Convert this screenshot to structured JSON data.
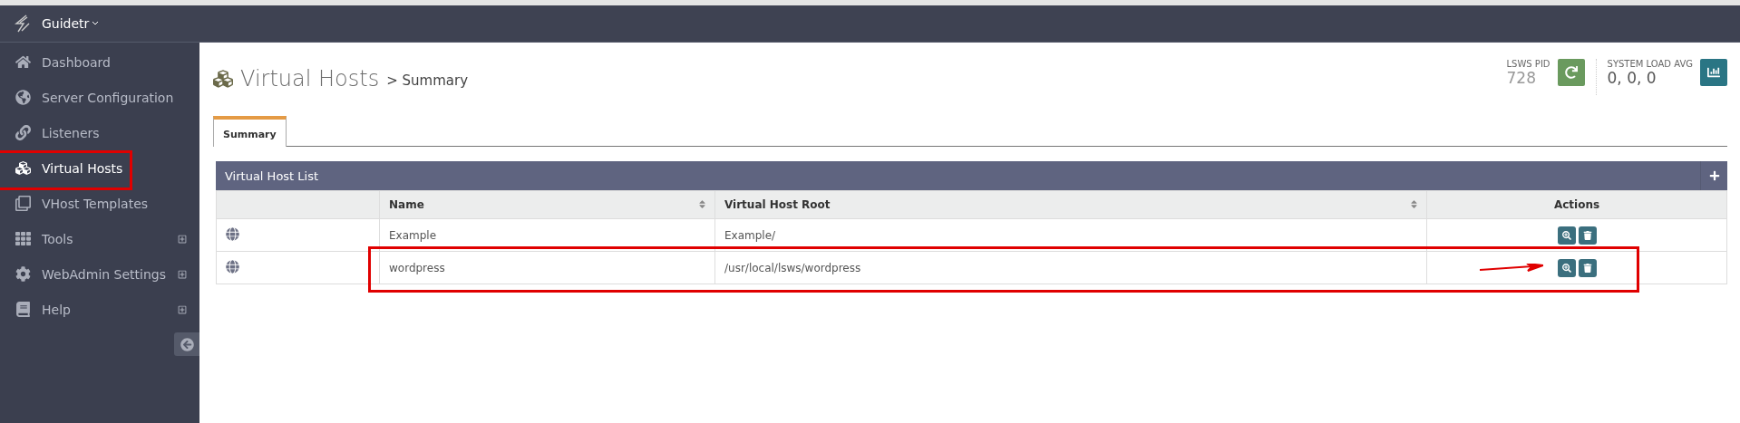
{
  "brand": {
    "name": "Guidetr"
  },
  "sidebar": {
    "items": [
      {
        "label": "Dashboard",
        "selected": false,
        "expandable": false,
        "highlighted": false
      },
      {
        "label": "Server Configuration",
        "selected": false,
        "expandable": false,
        "highlighted": false
      },
      {
        "label": "Listeners",
        "selected": false,
        "expandable": false,
        "highlighted": false
      },
      {
        "label": "Virtual Hosts",
        "selected": true,
        "expandable": false,
        "highlighted": true
      },
      {
        "label": "VHost Templates",
        "selected": false,
        "expandable": false,
        "highlighted": false
      },
      {
        "label": "Tools",
        "selected": false,
        "expandable": true,
        "highlighted": false
      },
      {
        "label": "WebAdmin Settings",
        "selected": false,
        "expandable": true,
        "highlighted": false
      },
      {
        "label": "Help",
        "selected": false,
        "expandable": true,
        "highlighted": false
      }
    ]
  },
  "page": {
    "title": "Virtual Hosts",
    "crumb": "> Summary"
  },
  "status": {
    "pid_label": "LSWS PID",
    "pid": "728",
    "load_label": "SYSTEM LOAD AVG",
    "load": "0, 0, 0"
  },
  "tabs": [
    {
      "label": "Summary",
      "selected": true
    }
  ],
  "panel": {
    "title": "Virtual Host List",
    "columns": [
      {
        "sortable": false
      },
      {
        "label": "Name",
        "sortable": true
      },
      {
        "label": "Virtual Host Root",
        "sortable": true
      },
      {
        "label": "Actions",
        "sortable": false
      }
    ],
    "rows": [
      {
        "name": "Example",
        "root": "Example/",
        "highlighted": false
      },
      {
        "name": "wordpress",
        "root": "/usr/local/lsws/wordpress",
        "highlighted": true
      }
    ]
  }
}
